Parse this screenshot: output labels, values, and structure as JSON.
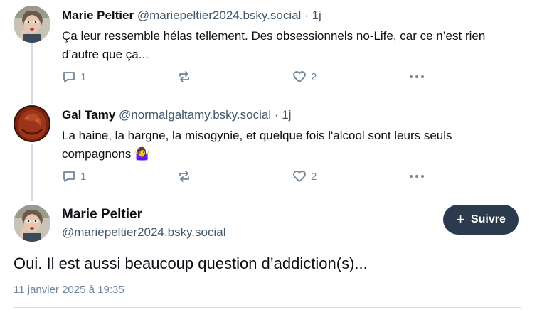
{
  "posts": [
    {
      "author_name": "Marie Peltier",
      "handle": "@mariepeltier2024.bsky.social",
      "separator": "·",
      "time": "1j",
      "text": "Ça leur ressemble hélas tellement. Des obsessionnels no-Life, car ce n’est rien d’autre que ça...",
      "reply_count": "1",
      "like_count": "2"
    },
    {
      "author_name": "Gal Tamy",
      "handle": "@normalgaltamy.bsky.social",
      "separator": "·",
      "time": "1j",
      "text": "La haine, la hargne, la misogynie, et quelque fois l'alcool sont leurs seuls compagnons",
      "emoji": "🤷‍♀️",
      "reply_count": "1",
      "like_count": "2"
    }
  ],
  "main_post": {
    "author_name": "Marie Peltier",
    "handle": "@mariepeltier2024.bsky.social",
    "follow_label": "Suivre",
    "follow_icon": "+",
    "text": "Oui. Il est aussi beaucoup question d’addiction(s)...",
    "date": "11 janvier 2025 à 19:35"
  },
  "icons": {
    "reply": "reply-icon",
    "repost": "repost-icon",
    "like": "heart-icon",
    "more": "more-icon"
  },
  "colors": {
    "text": "#0b0f14",
    "muted": "#42576c",
    "icon": "#6f869f",
    "follow_bg": "#2b3b4d",
    "thread_line": "#d4dbe2"
  }
}
